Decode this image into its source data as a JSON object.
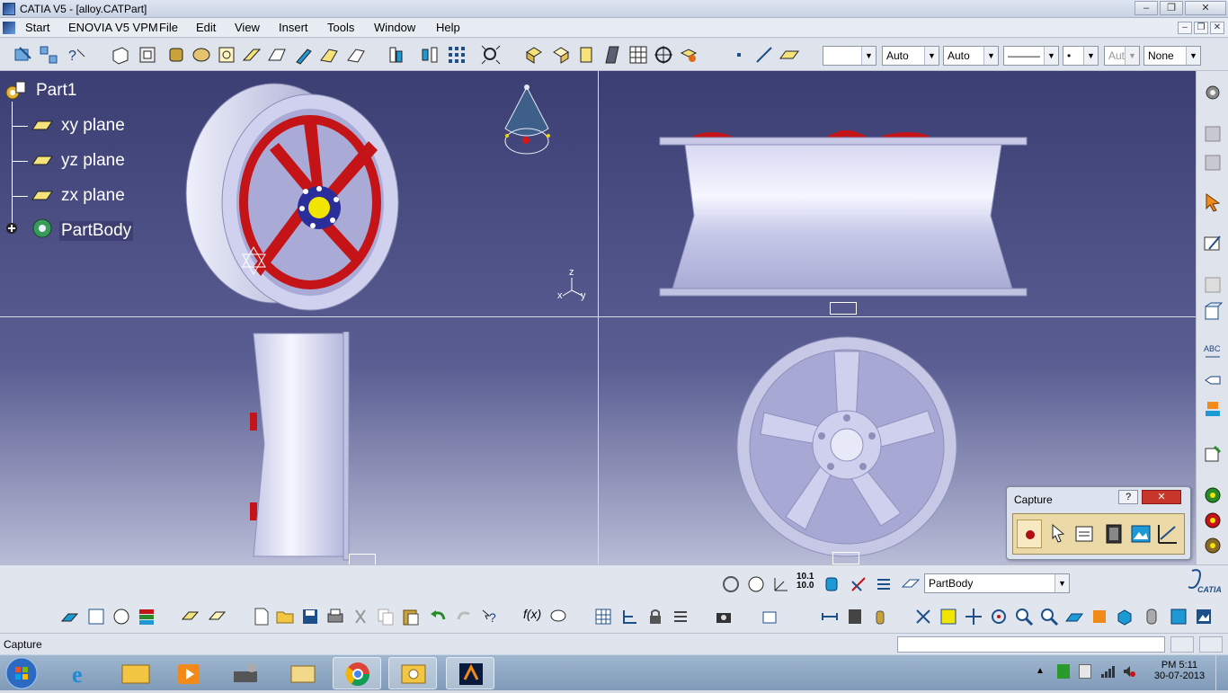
{
  "window": {
    "title": "CATIA V5 - [alloy.CATPart]"
  },
  "menu": {
    "items": [
      "Start",
      "ENOVIA V5 VPM",
      "File",
      "Edit",
      "View",
      "Insert",
      "Tools",
      "Window",
      "Help"
    ]
  },
  "toolbar": {
    "color_select": "",
    "line_type_1": "Auto",
    "line_type_2": "Auto",
    "line_style": "———",
    "point_style": "•",
    "layer_auto": "Aut",
    "layer": "None"
  },
  "tree": {
    "root": "Part1",
    "items": [
      "xy plane",
      "yz plane",
      "zx plane",
      "PartBody"
    ]
  },
  "compass_axes": {
    "z": "z",
    "x": "x",
    "y": "y"
  },
  "capture_dialog": {
    "title": "Capture",
    "help": "?",
    "close": "✕"
  },
  "bottom_toolbar": {
    "current_body": "PartBody",
    "zoom_label_top": "10.1",
    "zoom_label_bottom": "10.0"
  },
  "status": {
    "text": "Capture"
  },
  "taskbar": {
    "time": "PM 5:11",
    "date": "30-07-2013"
  },
  "colors": {
    "viewport_top": "#3b3e72",
    "wheel": "#c7c8e6",
    "spokes_red": "#c41418",
    "hub_yellow": "#f2e500",
    "hub_blue": "#2a2e9a"
  }
}
